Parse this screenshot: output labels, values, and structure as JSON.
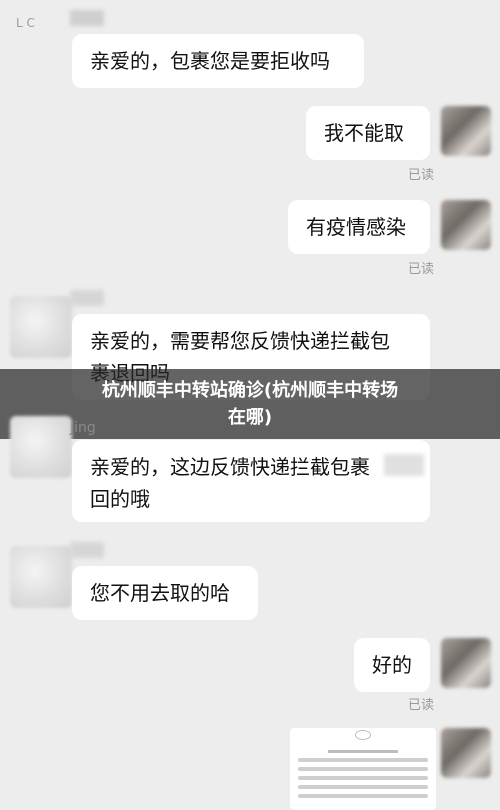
{
  "messages": {
    "m1": "亲爱的，包裹您是要拒收吗",
    "m2": "我不能取",
    "m2_status": "已读",
    "m3": "有疫情感染",
    "m3_status": "已读",
    "m4_line1": "亲爱的，需要帮您反馈快递拦截包",
    "m4_line2": "裹退回吗",
    "m5_line1": "亲爱的，这边反馈快递拦截包裹",
    "m5_line2": "回的哦",
    "m6": "您不用去取的哈",
    "m7": "好的",
    "m7_status": "已读"
  },
  "overlay": {
    "line1": "杭州顺丰中转站确诊(杭州顺丰中转场",
    "line2": "在哪)"
  },
  "labels": {
    "lc": "L C",
    "jing": "Jing"
  }
}
